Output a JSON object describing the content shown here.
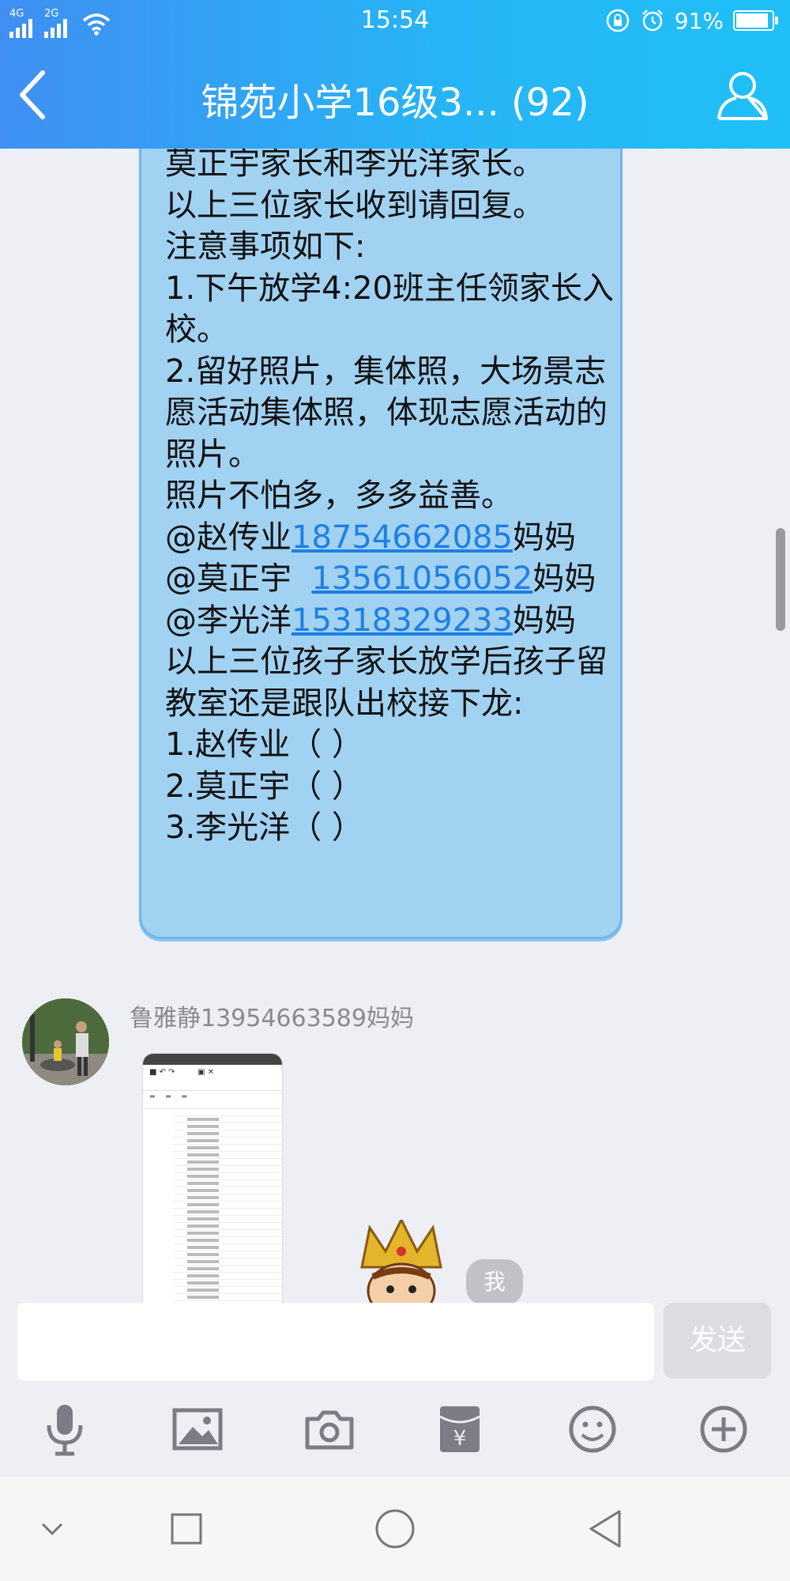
{
  "status": {
    "signal_4g": "4G",
    "signal_2g": "2G",
    "time": "15:54",
    "battery": "91%",
    "icons": [
      "signal-icon",
      "wifi-icon",
      "rotation-lock-icon",
      "alarm-icon",
      "battery-icon"
    ]
  },
  "header": {
    "title": "锦苑小学16级3... (92)",
    "back_icon": "chevron-left-icon",
    "members_icon": "person-icon"
  },
  "message": {
    "lines": [
      "莫正宇家长和李光洋家长。",
      "以上三位家长收到请回复。",
      "注意事项如下:",
      "1.下午放学4:20班主任领家长入校。",
      "2.留好照片，集体照，大场景志愿活动集体照，体现志愿活动的照片。",
      "照片不怕多，多多益善。"
    ],
    "mention1": "@赵传业",
    "phone1": "18754662085",
    "suffix1": "妈妈",
    "mention2": "@莫正宇  ",
    "phone2": "13561056052",
    "suffix2": "妈妈 ",
    "mention3": "@李光洋",
    "phone3": "15318329233",
    "suffix3": "妈妈",
    "question": "以上三位孩子家长放学后孩子留教室还是跟队出校接下龙:",
    "options": [
      "1.赵传业（ ）",
      "2.莫正宇（ ）",
      "3.李光洋（ ）"
    ]
  },
  "incoming": {
    "sender": "鲁雅静13954663589妈妈",
    "me_label": "我"
  },
  "input": {
    "placeholder": "",
    "send_label": "发送"
  },
  "toolbar_icons": [
    "microphone-icon",
    "image-icon",
    "camera-icon",
    "red-packet-icon",
    "emoji-icon",
    "plus-icon"
  ],
  "nav_icons": [
    "chevron-down-icon",
    "recents-square-icon",
    "home-circle-icon",
    "back-triangle-icon"
  ],
  "colors": {
    "header_start": "#3f8ff2",
    "header_end": "#1fc0f7",
    "bubble": "#a2d2f2",
    "link": "#1e7fe4",
    "background": "#eeeff4"
  }
}
